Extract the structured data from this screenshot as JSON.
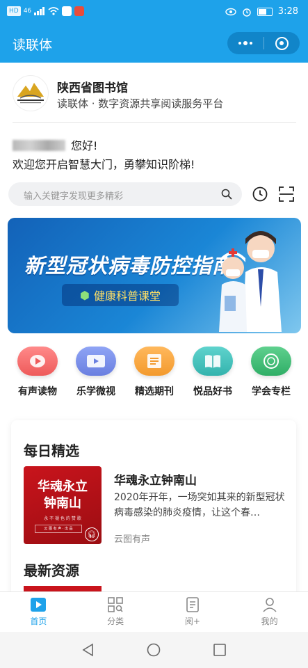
{
  "status_bar": {
    "left_badges": [
      "HD",
      "46"
    ],
    "time": "3:28"
  },
  "navbar": {
    "title": "读联体",
    "colors": {
      "primary": "#1ea2ea",
      "capsule": "#1185c9"
    }
  },
  "library": {
    "name": "陕西省图书馆",
    "subtitle": "读联体 · 数字资源共享阅读服务平台"
  },
  "greeting": {
    "hello": "您好!",
    "welcome": "欢迎您开启智慧大门，勇攀知识阶梯!"
  },
  "search": {
    "placeholder": "输入关键字发现更多精彩"
  },
  "banner": {
    "title": "新型冠状病毒防控指南",
    "tag": "健康科普课堂"
  },
  "categories": [
    {
      "label": "有声读物",
      "icon": "headphone-icon",
      "color": "#f06b6b"
    },
    {
      "label": "乐学微视",
      "icon": "video-icon",
      "color": "#6f86e8"
    },
    {
      "label": "精选期刊",
      "icon": "magazine-icon",
      "color": "#f5a03c"
    },
    {
      "label": "悦品好书",
      "icon": "book-icon",
      "color": "#3fbcb7"
    },
    {
      "label": "学会专栏",
      "icon": "society-icon",
      "color": "#3dbb74"
    }
  ],
  "daily": {
    "title": "每日精选",
    "item": {
      "cover_title_line1": "华魂永立",
      "cover_title_line2": "钟南山",
      "cover_subtitle": "永 不 褪 色 的 赞 歌",
      "cover_badge": "云 图 有 声 · 出 品",
      "title": "华魂永立钟南山",
      "description": "2020年开年，一场突如其来的新型冠状病毒感染的肺炎疫情，让这个春…",
      "source": "云图有声"
    }
  },
  "latest": {
    "title": "最新资源"
  },
  "tabbar": [
    {
      "label": "首页",
      "icon": "home-play-icon",
      "active": true
    },
    {
      "label": "分类",
      "icon": "grid-category-icon",
      "active": false
    },
    {
      "label": "阅+",
      "icon": "reading-doc-icon",
      "active": false
    },
    {
      "label": "我的",
      "icon": "user-icon",
      "active": false
    }
  ]
}
